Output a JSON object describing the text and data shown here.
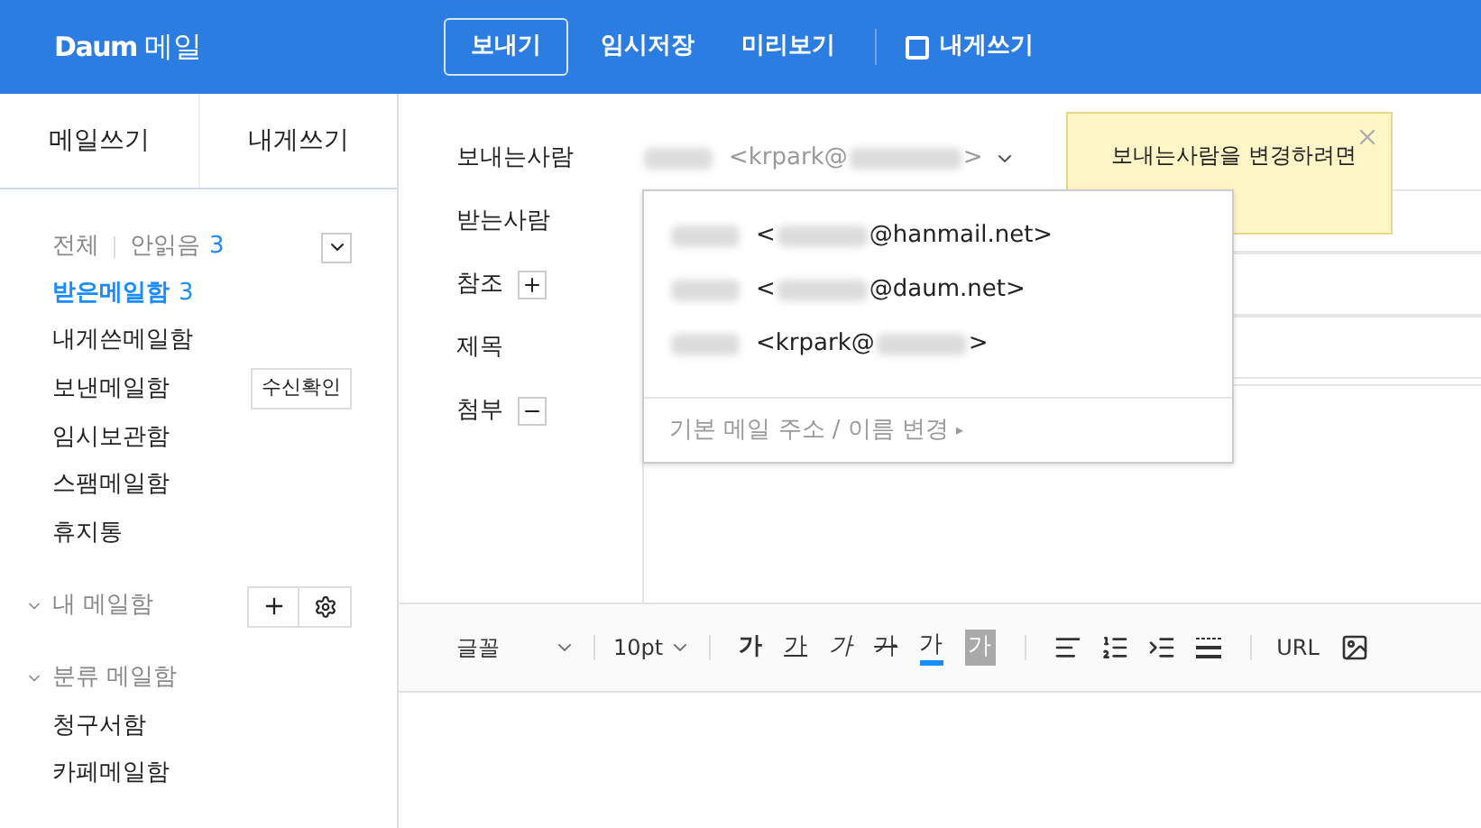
{
  "header": {
    "logo": "Daum",
    "app": "메일",
    "actions": [
      {
        "label": "보내기",
        "kind": "primary"
      },
      {
        "label": "임시저장",
        "kind": "plain"
      },
      {
        "label": "미리보기",
        "kind": "plain"
      },
      {
        "label": "내게쓰기",
        "kind": "checkbox",
        "checked": false
      }
    ]
  },
  "sidebar": {
    "tabs": [
      {
        "label": "메일쓰기"
      },
      {
        "label": "내게쓰기"
      }
    ],
    "filter": {
      "all": "전체",
      "unread": "안읽음",
      "unread_count": "3"
    },
    "folders": [
      {
        "label": "받은메일함",
        "count": "3",
        "selected": true
      },
      {
        "label": "내게쓴메일함",
        "selected": false
      },
      {
        "label": "보낸메일함",
        "badge": "수신확인",
        "selected": false
      },
      {
        "label": "임시보관함",
        "selected": false
      },
      {
        "label": "스팸메일함",
        "selected": false
      },
      {
        "label": "휴지통",
        "selected": false
      }
    ],
    "sections": [
      {
        "label": "내 메일함",
        "tools": true
      },
      {
        "label": "분류 메일함",
        "tools": false,
        "children": [
          {
            "label": "청구서함"
          },
          {
            "label": "카페메일함"
          }
        ]
      }
    ]
  },
  "compose": {
    "fields": [
      {
        "label": "보내는사람",
        "kind": "sender"
      },
      {
        "label": "받는사람",
        "kind": "input"
      },
      {
        "label": "참조",
        "kind": "input",
        "expanded": false
      },
      {
        "label": "제목",
        "kind": "input"
      },
      {
        "label": "첨부",
        "kind": "attach",
        "expanded": true
      }
    ],
    "sender": {
      "prefix": "<krpark@",
      "suffix": ">"
    },
    "tooltip": {
      "lines": [
        "보내는사람을 변경하려면"
      ]
    },
    "dropdown": {
      "addresses": [
        {
          "prefix": "<",
          "suffix": "@hanmail.net>"
        },
        {
          "prefix": "<",
          "suffix": "@daum.net>"
        },
        {
          "prefix": "<krpark@",
          "suffix": ">"
        }
      ],
      "footer": "기본 메일 주소 / 이름 변경",
      "footer_arrow": "▸"
    }
  },
  "toolbar": {
    "font": "글꼴",
    "size": "10pt",
    "styles": [
      {
        "label": "가",
        "kind": "bold"
      },
      {
        "label": "가",
        "kind": "underline"
      },
      {
        "label": "가",
        "kind": "italic"
      },
      {
        "label": "가",
        "kind": "strike"
      },
      {
        "label": "가",
        "kind": "color"
      },
      {
        "label": "가",
        "kind": "background"
      }
    ],
    "url": "URL"
  }
}
